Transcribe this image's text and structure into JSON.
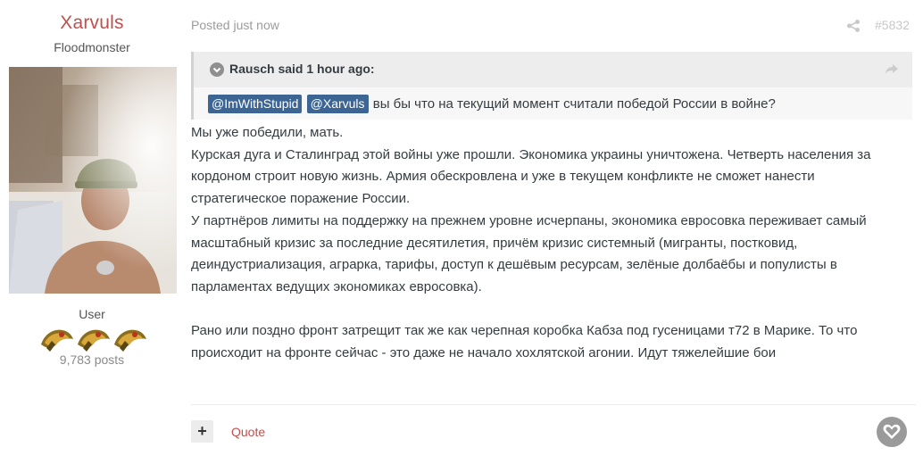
{
  "author": {
    "name": "Xarvuls",
    "title": "Floodmonster",
    "group": "User",
    "posts": "9,783 posts"
  },
  "post": {
    "meta": "Posted just now",
    "number": "#5832",
    "quote": {
      "header": "Rausch said 1 hour ago:",
      "mentions": [
        "@ImWithStupid",
        "@Xarvuls"
      ],
      "text": "вы бы что на текущий момент считали победой России в войне?"
    },
    "lines": [
      "Мы уже победили, мать.",
      "Курская дуга и Сталинград этой войны уже прошли. Экономика украины уничтожена. Четверть населения за",
      "кордоном строит новую жизнь. Армия обескровлена и уже в текущем конфликте не сможет нанести",
      "стратегическое поражение России.",
      "У партнёров лимиты на поддержку на прежнем уровне исчерпаны, экономика евросовка переживает самый",
      "масштабный кризис за последние десятилетия, причём кризис системный (мигранты, постковид,",
      "деиндустриализация, аграрка, тарифы, доступ к дешёвым ресурсам, зелёные долбаёбы и популисты в",
      "парламентах ведущих экономиках евросовка).",
      "Рано или поздно фронт затрещит так же как черепная коробка Кабза под гусеницами т72 в Марике. То что",
      "происходит на фронте сейчас - это даже не начало хохлятской агонии. Идут тяжелейшие бои"
    ]
  },
  "footer": {
    "plus_label": "+",
    "quote_label": "Quote"
  },
  "colors": {
    "author_name": "#c0504d",
    "mention_bg": "#3d6594",
    "quote_head_bg": "#ededed",
    "quote_bg": "#f7f7f7"
  },
  "icons": [
    "share-icon",
    "collapse-icon",
    "quote-link-icon",
    "heart-icon",
    "rank-icon"
  ]
}
